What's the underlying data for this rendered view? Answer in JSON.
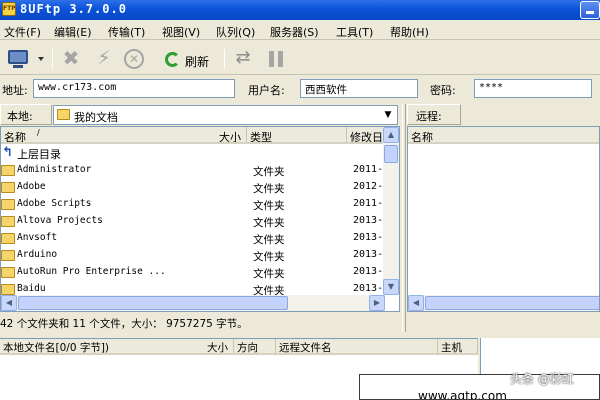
{
  "window": {
    "title": "8UFtp 3.7.0.0",
    "icon_label": "FTP"
  },
  "menu": [
    "文件(F)",
    "编辑(E)",
    "传输(T)",
    "视图(V)",
    "队列(Q)",
    "服务器(S)",
    "工具(T)",
    "帮助(H)"
  ],
  "toolbar": {
    "refresh_label": "刷新"
  },
  "address": {
    "address_label": "地址:",
    "address_value": "www.cr173.com",
    "username_label": "用户名:",
    "username_value": "西西软件",
    "password_label": "密码:",
    "password_value": "****"
  },
  "local": {
    "label": "本地:",
    "path": "我的文档",
    "columns": {
      "name": "名称",
      "size": "大小",
      "type": "类型",
      "modified": "修改日"
    },
    "up_label": "上层目录",
    "rows": [
      {
        "name": "Administrator",
        "type": "文件夹",
        "date": "2011-"
      },
      {
        "name": "Adobe",
        "type": "文件夹",
        "date": "2012-"
      },
      {
        "name": "Adobe Scripts",
        "type": "文件夹",
        "date": "2011-"
      },
      {
        "name": "Altova Projects",
        "type": "文件夹",
        "date": "2013-"
      },
      {
        "name": "Anvsoft",
        "type": "文件夹",
        "date": "2013-"
      },
      {
        "name": "Arduino",
        "type": "文件夹",
        "date": "2013-"
      },
      {
        "name": "AutoRun Pro Enterprise ...",
        "type": "文件夹",
        "date": "2013-"
      },
      {
        "name": "Baidu",
        "type": "文件夹",
        "date": "2013-"
      }
    ],
    "status": "42 个文件夹和 11 个文件，大小：  9757275 字节。"
  },
  "remote": {
    "label": "远程:",
    "columns": {
      "name": "名称"
    }
  },
  "queue": {
    "columns": {
      "local_file": "本地文件名[0/0 字节])",
      "size": "大小",
      "direction": "方向",
      "remote_file": "远程文件名",
      "host": "主机"
    }
  },
  "popup": {
    "text": "www.aqtp.com"
  },
  "watermark": {
    "text": "头条 @彩虹"
  },
  "colors": {
    "titlebar": "#0A53D9",
    "window_bg": "#ECE9D8",
    "folder": "#F6D568",
    "refresh_icon": "#2E9E2E"
  }
}
